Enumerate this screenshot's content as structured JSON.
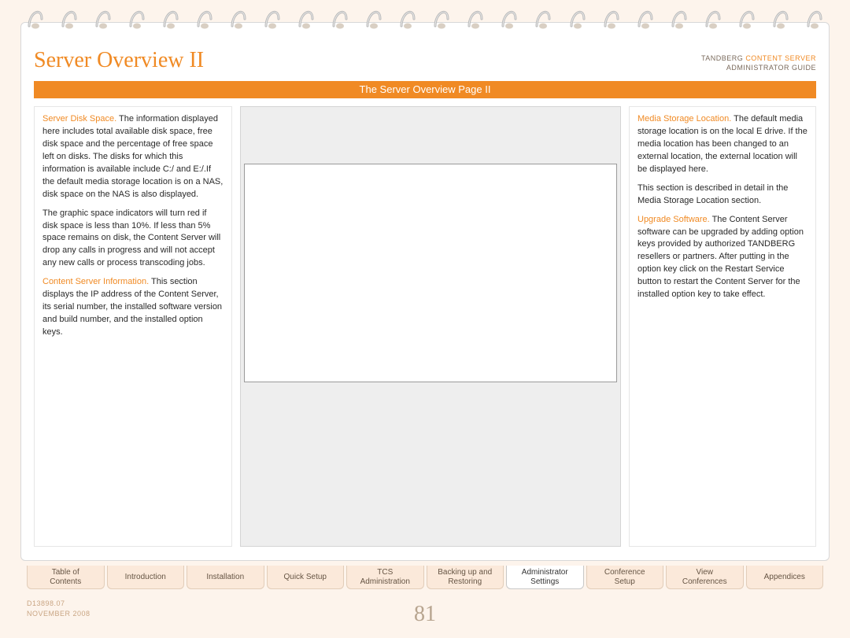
{
  "header": {
    "title": "Server Overview II",
    "brand_line1a": "TANDBERG ",
    "brand_line1b": "CONTENT SERVER",
    "brand_line2": "ADMINISTRATOR GUIDE"
  },
  "section_bar": "The Server Overview Page II",
  "left": {
    "p1_label": "Server Disk Space.",
    "p1_text": " The information displayed here includes total available disk space, free disk space and the percentage of free space left on disks. The disks for which this information is available include C:/ and E:/.If the default media storage location is on a NAS, disk space on the NAS is also displayed.",
    "p2_text": "The graphic space indicators will turn red if disk space is less than 10%. If less than 5% space remains on disk, the Content Server will drop any calls in progress and will not accept any new calls or process transcoding jobs.",
    "p3_label": "Content Server Information.",
    "p3_text": " This section displays the IP address of the Content Server, its serial number, the installed software version and build number, and the installed option keys."
  },
  "right": {
    "p1_label": "Media Storage Location.",
    "p1_text": " The default media storage location is on the local E drive. If the media location has been changed to an external location, the external location will be displayed here.",
    "p2_text": "This section is described in detail in the Media Storage Location section.",
    "p3_label": "Upgrade Software.",
    "p3_text": " The Content Server software can be upgraded by adding option keys provided by authorized TANDBERG resellers or partners. After putting in the option key click on the Restart Service button to restart the Content Server for the installed option key to take effect."
  },
  "tabs": [
    "Table of\nContents",
    "Introduction",
    "Installation",
    "Quick Setup",
    "TCS\nAdministration",
    "Backing up and\nRestoring",
    "Administrator\nSettings",
    "Conference\nSetup",
    "View\nConferences",
    "Appendices"
  ],
  "active_tab_index": 6,
  "footer": {
    "doc_id": "D13898.07",
    "date": "NOVEMBER 2008",
    "page_number": "81"
  }
}
